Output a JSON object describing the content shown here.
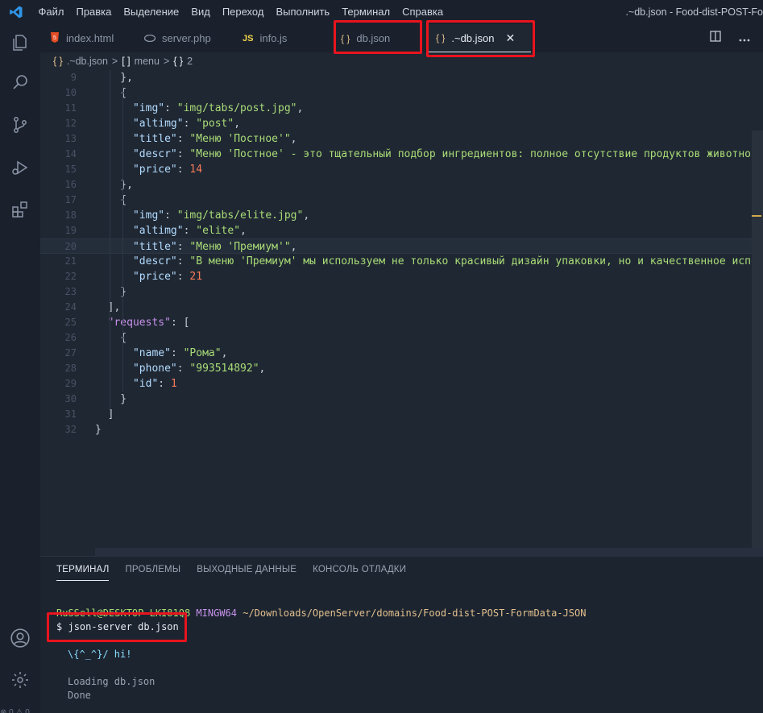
{
  "menu": [
    "Файл",
    "Правка",
    "Выделение",
    "Вид",
    "Переход",
    "Выполнить",
    "Терминал",
    "Справка"
  ],
  "window_title": ".~db.json - Food-dist-POST-Fo",
  "tabs": [
    {
      "label": "index.html",
      "icon": "html-icon",
      "icon_text": "5",
      "active": false
    },
    {
      "label": "server.php",
      "icon": "php-icon",
      "icon_text": "",
      "active": false
    },
    {
      "label": "info.js",
      "icon": "js-icon",
      "icon_text": "JS",
      "active": false
    },
    {
      "label": "db.json",
      "icon": "json-icon",
      "icon_text": "{ }",
      "active": false
    },
    {
      "label": ".~db.json",
      "icon": "json-icon",
      "icon_text": "{ }",
      "active": true,
      "close": "✕"
    }
  ],
  "breadcrumb": {
    "file_icon": "{ }",
    "file": ".~db.json",
    "sep": ">",
    "arr_icon": "[ ]",
    "arr": "menu",
    "obj_icon": "{ }",
    "obj": "2"
  },
  "code_lines": [
    {
      "n": "9",
      "t": [
        [
          "p",
          "    },"
        ]
      ]
    },
    {
      "n": "10",
      "t": [
        [
          "p",
          "    {"
        ]
      ]
    },
    {
      "n": "11",
      "t": [
        [
          "p",
          "      "
        ],
        [
          "key",
          "\"img\""
        ],
        [
          "p",
          ": "
        ],
        [
          "s",
          "\"img/tabs/post.jpg\""
        ],
        [
          "p",
          ","
        ]
      ]
    },
    {
      "n": "12",
      "t": [
        [
          "p",
          "      "
        ],
        [
          "key",
          "\"altimg\""
        ],
        [
          "p",
          ": "
        ],
        [
          "s",
          "\"post\""
        ],
        [
          "p",
          ","
        ]
      ]
    },
    {
      "n": "13",
      "t": [
        [
          "p",
          "      "
        ],
        [
          "key",
          "\"title\""
        ],
        [
          "p",
          ": "
        ],
        [
          "s",
          "\"Меню 'Постное'\""
        ],
        [
          "p",
          ","
        ]
      ]
    },
    {
      "n": "14",
      "t": [
        [
          "p",
          "      "
        ],
        [
          "key",
          "\"descr\""
        ],
        [
          "p",
          ": "
        ],
        [
          "s",
          "\"Меню 'Постное' - это тщательный подбор ингредиентов: полное отсутствие продуктов животного"
        ]
      ]
    },
    {
      "n": "15",
      "t": [
        [
          "p",
          "      "
        ],
        [
          "key",
          "\"price\""
        ],
        [
          "p",
          ": "
        ],
        [
          "n",
          "14"
        ]
      ]
    },
    {
      "n": "16",
      "t": [
        [
          "p",
          "    },"
        ]
      ]
    },
    {
      "n": "17",
      "t": [
        [
          "p",
          "    {"
        ]
      ]
    },
    {
      "n": "18",
      "t": [
        [
          "p",
          "      "
        ],
        [
          "key",
          "\"img\""
        ],
        [
          "p",
          ": "
        ],
        [
          "s",
          "\"img/tabs/elite.jpg\""
        ],
        [
          "p",
          ","
        ]
      ]
    },
    {
      "n": "19",
      "t": [
        [
          "p",
          "      "
        ],
        [
          "key",
          "\"altimg\""
        ],
        [
          "p",
          ": "
        ],
        [
          "s",
          "\"elite\""
        ],
        [
          "p",
          ","
        ]
      ]
    },
    {
      "n": "20",
      "t": [
        [
          "p",
          "      "
        ],
        [
          "key",
          "\"title\""
        ],
        [
          "p",
          ": "
        ],
        [
          "s",
          "\"Меню 'Премиум'\""
        ],
        [
          "p",
          ","
        ]
      ]
    },
    {
      "n": "21",
      "t": [
        [
          "p",
          "      "
        ],
        [
          "key",
          "\"descr\""
        ],
        [
          "p",
          ": "
        ],
        [
          "s",
          "\"В меню 'Премиум' мы используем не только красивый дизайн упаковки, но и качественное исполн"
        ]
      ]
    },
    {
      "n": "22",
      "t": [
        [
          "p",
          "      "
        ],
        [
          "key",
          "\"price\""
        ],
        [
          "p",
          ": "
        ],
        [
          "n",
          "21"
        ]
      ]
    },
    {
      "n": "23",
      "t": [
        [
          "p",
          "    }"
        ]
      ]
    },
    {
      "n": "24",
      "t": [
        [
          "p",
          "  ],"
        ]
      ]
    },
    {
      "n": "25",
      "t": [
        [
          "p",
          "  "
        ],
        [
          "kp",
          "\"requests\""
        ],
        [
          "p",
          ": ["
        ]
      ]
    },
    {
      "n": "26",
      "t": [
        [
          "p",
          "    {"
        ]
      ]
    },
    {
      "n": "27",
      "t": [
        [
          "p",
          "      "
        ],
        [
          "key",
          "\"name\""
        ],
        [
          "p",
          ": "
        ],
        [
          "s",
          "\"Рома\""
        ],
        [
          "p",
          ","
        ]
      ]
    },
    {
      "n": "28",
      "t": [
        [
          "p",
          "      "
        ],
        [
          "key",
          "\"phone\""
        ],
        [
          "p",
          ": "
        ],
        [
          "s",
          "\"993514892\""
        ],
        [
          "p",
          ","
        ]
      ]
    },
    {
      "n": "29",
      "t": [
        [
          "p",
          "      "
        ],
        [
          "key",
          "\"id\""
        ],
        [
          "p",
          ": "
        ],
        [
          "n",
          "1"
        ]
      ]
    },
    {
      "n": "30",
      "t": [
        [
          "p",
          "    }"
        ]
      ]
    },
    {
      "n": "31",
      "t": [
        [
          "p",
          "  ]"
        ]
      ]
    },
    {
      "n": "32",
      "t": [
        [
          "p",
          "}"
        ]
      ]
    }
  ],
  "current_line": "20",
  "panel_tabs": [
    "ТЕРМИНАЛ",
    "ПРОБЛЕМЫ",
    "ВЫХОДНЫЕ ДАННЫЕ",
    "КОНСОЛЬ ОТЛАДКИ"
  ],
  "terminal": {
    "user": "RuSSell@DESKTOP-LKI81Q8",
    "env": "MINGW64",
    "path": "~/Downloads/OpenServer/domains/Food-dist-POST-FormData-JSON",
    "prompt": "$",
    "command": "json-server db.json",
    "hi": "\\{^_^}/ hi!",
    "loading": "Loading db.json",
    "done": "Done"
  },
  "status": {
    "errors": "0",
    "warnings": "0"
  },
  "colors": {
    "highlight": "#e8141e",
    "accent": "#e6ebf2"
  }
}
